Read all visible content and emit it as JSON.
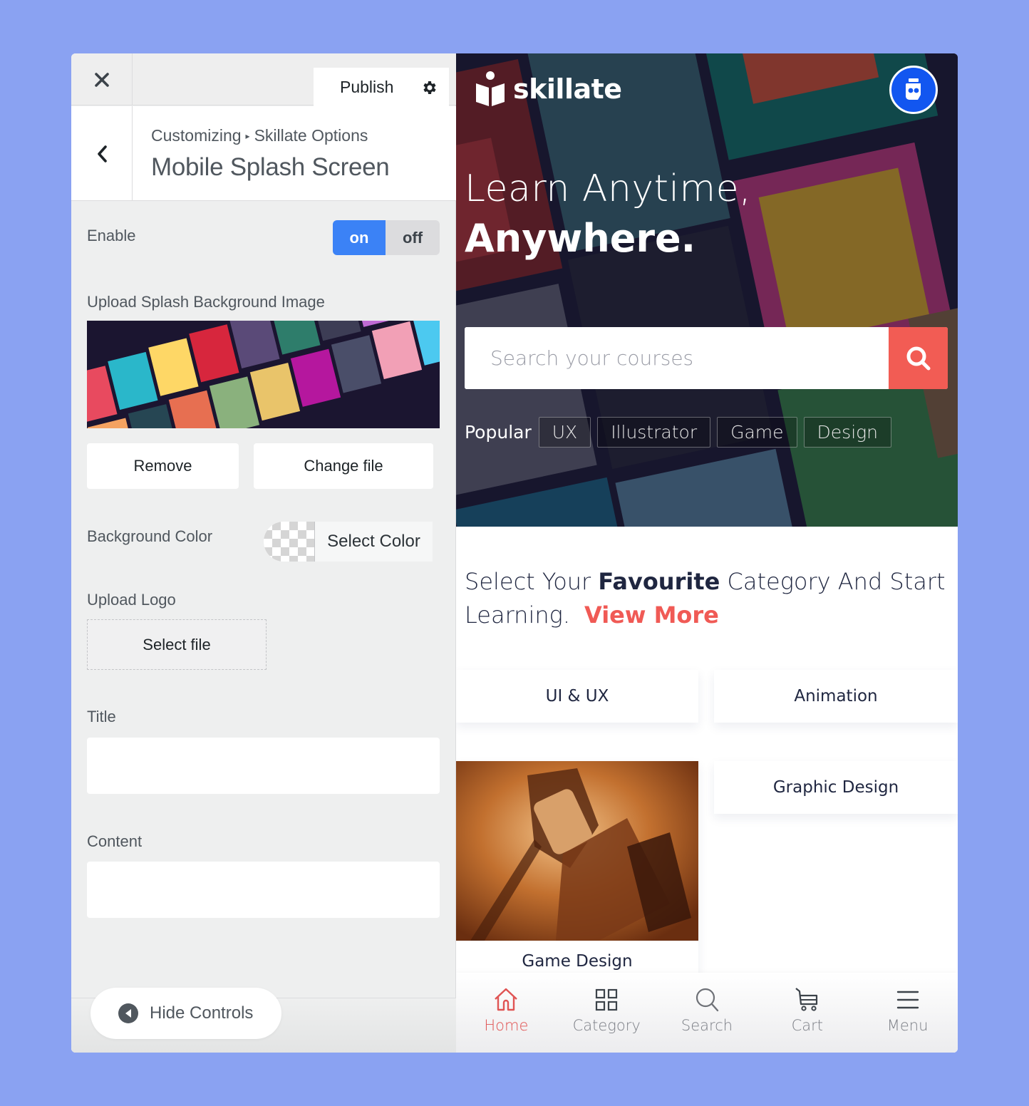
{
  "customizer": {
    "close_label": "Close",
    "publish_label": "Publish",
    "breadcrumb_root": "Customizing",
    "breadcrumb_separator": "▸",
    "breadcrumb_parent": "Skillate Options",
    "section_title": "Mobile Splash Screen",
    "enable": {
      "label": "Enable",
      "on_label": "on",
      "off_label": "off",
      "selected": "on"
    },
    "splash_bg": {
      "label": "Upload Splash Background Image",
      "remove_label": "Remove",
      "change_label": "Change file"
    },
    "bg_color": {
      "label": "Background Color",
      "button_label": "Select Color"
    },
    "logo": {
      "label": "Upload Logo",
      "button_label": "Select file"
    },
    "title_field": {
      "label": "Title",
      "value": ""
    },
    "content_field": {
      "label": "Content",
      "value": ""
    },
    "hide_controls_label": "Hide Controls"
  },
  "preview": {
    "brand": "skillate",
    "hero_line1": "Learn Anytime,",
    "hero_line2": "Anywhere.",
    "search_placeholder": "Search your courses",
    "popular_label": "Popular",
    "popular_tags": [
      "UX",
      "Illustrator",
      "Game",
      "Design"
    ],
    "category_heading": {
      "pre": "Select Your ",
      "bold": "Favourite",
      "post": " Category And Start Learning.",
      "link": "View More"
    },
    "categories": [
      "UI & UX",
      "Animation",
      "Game Design",
      "Graphic Design"
    ],
    "bottom_nav": [
      {
        "label": "Home",
        "icon": "home-icon",
        "active": true
      },
      {
        "label": "Category",
        "icon": "grid-icon",
        "active": false
      },
      {
        "label": "Search",
        "icon": "search-icon",
        "active": false
      },
      {
        "label": "Cart",
        "icon": "cart-icon",
        "active": false
      },
      {
        "label": "Menu",
        "icon": "menu-icon",
        "active": false
      }
    ]
  },
  "colors": {
    "accent_blue": "#3b82f6",
    "brand_red": "#f25c54",
    "badge_blue": "#1256f0",
    "page_bg": "#8aa2f2"
  }
}
